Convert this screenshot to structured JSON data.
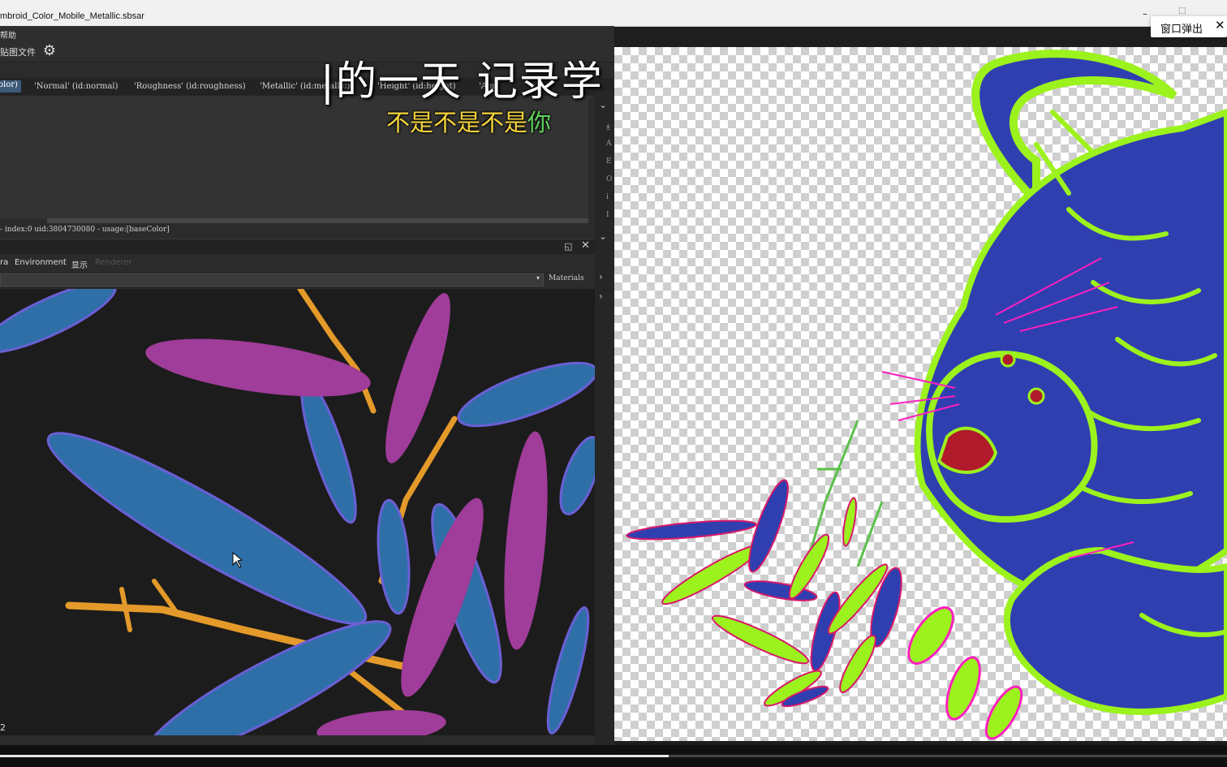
{
  "bookmarks": [
    "",
    "",
    "",
    "",
    "",
    ""
  ],
  "window": {
    "title": "mbroid_Color_Mobile_Metallic.sbsar",
    "minimize_glyph": "–",
    "restore_glyph": "⬚"
  },
  "popout": {
    "label": "窗口弹出",
    "close_icon": "✕"
  },
  "menu": {
    "item": "帮助"
  },
  "toolbar": {
    "file_button": "贴图文件",
    "settings_icon": "gear-icon"
  },
  "overlay": {
    "text": "|的一天 记录学"
  },
  "subtitle": {
    "part1": "不是不是不是",
    "part2": "你"
  },
  "outputs": {
    "tabs": [
      "olor)",
      "'Normal' (id:normal)",
      "'Roughness' (id:roughness)",
      "'Metallic' (id:metallic)",
      "'Height' (id:height)",
      "'Am"
    ]
  },
  "status": {
    "text": "- index:0 uid:3804730080 - usage:[baseColor]"
  },
  "side_strip": {
    "chevrons": [
      "⌄",
      "⌄",
      "›",
      "›"
    ],
    "letters": [
      "纟",
      "A",
      "E",
      "O",
      "i",
      "I"
    ]
  },
  "viewer": {
    "tabs": [
      "ra",
      "Environment",
      "显示",
      "Renderer"
    ],
    "materials_label": "Materials",
    "dropdown_arrow": "▾",
    "undock_icon": "◱",
    "close_icon": "✕",
    "corner_number": "2"
  },
  "colors": {
    "tiger_blue": "#2f3fb0",
    "tiger_green": "#9cf21c",
    "leaf_blue": "#2f6fa8",
    "leaf_magenta": "#a03c9a",
    "branch_orange": "#e49a2a",
    "accent_pink": "#ff1fbf"
  },
  "video": {
    "progress": 0.545
  }
}
